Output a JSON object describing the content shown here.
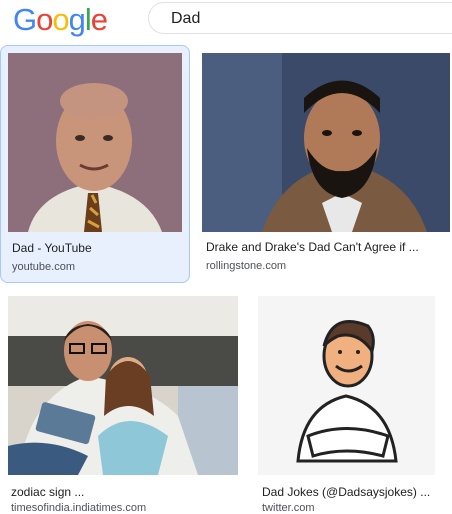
{
  "logo": {
    "letters": [
      "G",
      "o",
      "o",
      "g",
      "l",
      "e"
    ]
  },
  "search": {
    "query": "Dad"
  },
  "results": [
    {
      "title": "Dad - YouTube",
      "source": "youtube.com"
    },
    {
      "title": "Drake and Drake's Dad Can't Agree if ...",
      "source": "rollingstone.com"
    },
    {
      "title": "zodiac sign ...",
      "source": "timesofindia.indiatimes.com"
    },
    {
      "title": "Dad Jokes (@Dadsaysjokes) ...",
      "source": "twitter.com"
    }
  ],
  "colors": {
    "blue": "#4285f4",
    "red": "#ea4335",
    "yellow": "#fbbc05",
    "green": "#34a853",
    "selected_bg": "#e8f0fe"
  }
}
